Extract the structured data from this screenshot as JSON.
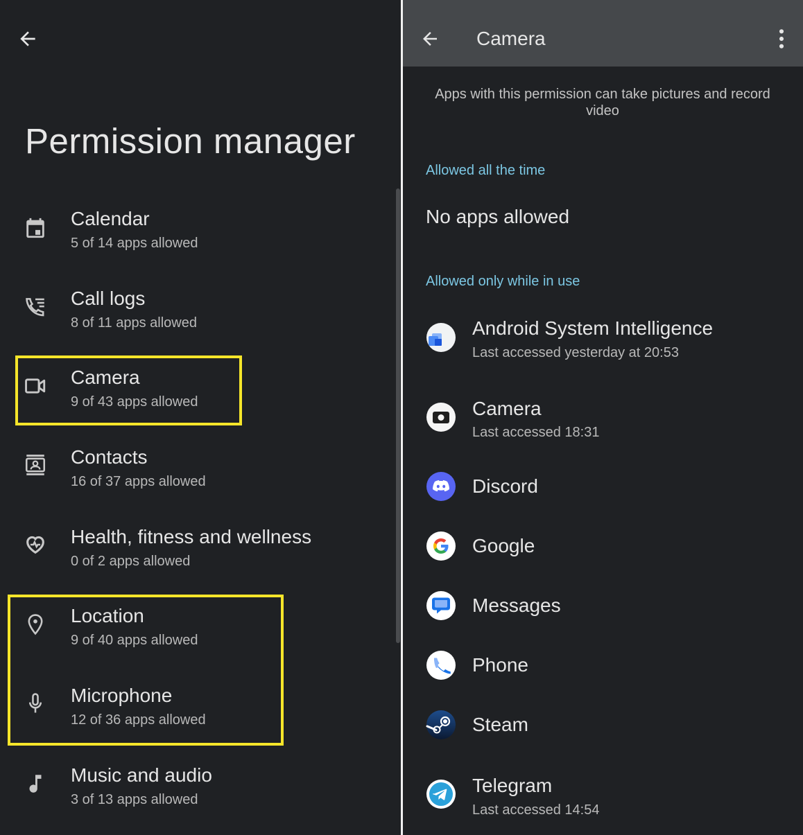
{
  "left": {
    "title": "Permission manager",
    "permissions": [
      {
        "label": "Calendar",
        "summary": "5 of 14 apps allowed",
        "icon": "calendar-icon"
      },
      {
        "label": "Call logs",
        "summary": "8 of 11 apps allowed",
        "icon": "call-log-icon"
      },
      {
        "label": "Camera",
        "summary": "9 of 43 apps allowed",
        "icon": "camera-icon"
      },
      {
        "label": "Contacts",
        "summary": "16 of 37 apps allowed",
        "icon": "contacts-icon"
      },
      {
        "label": "Health, fitness and wellness",
        "summary": "0 of 2 apps allowed",
        "icon": "health-icon"
      },
      {
        "label": "Location",
        "summary": "9 of 40 apps allowed",
        "icon": "location-icon"
      },
      {
        "label": "Microphone",
        "summary": "12 of 36 apps allowed",
        "icon": "microphone-icon"
      },
      {
        "label": "Music and audio",
        "summary": "3 of 13 apps allowed",
        "icon": "music-icon"
      }
    ]
  },
  "right": {
    "title": "Camera",
    "description": "Apps with this permission can take pictures and record video",
    "allowed_all_time_header": "Allowed all the time",
    "allowed_all_time_empty": "No apps allowed",
    "allowed_in_use_header": "Allowed only while in use",
    "apps": [
      {
        "name": "Android System Intelligence",
        "detail": "Last accessed yesterday at 20:53",
        "icon": "android-system-intelligence-icon"
      },
      {
        "name": "Camera",
        "detail": "Last accessed 18:31",
        "icon": "camera-app-icon"
      },
      {
        "name": "Discord",
        "detail": "",
        "icon": "discord-icon"
      },
      {
        "name": "Google",
        "detail": "",
        "icon": "google-icon"
      },
      {
        "name": "Messages",
        "detail": "",
        "icon": "messages-icon"
      },
      {
        "name": "Phone",
        "detail": "",
        "icon": "phone-icon"
      },
      {
        "name": "Steam",
        "detail": "",
        "icon": "steam-icon"
      },
      {
        "name": "Telegram",
        "detail": "Last accessed 14:54",
        "icon": "telegram-icon"
      }
    ]
  },
  "colors": {
    "background": "#1f2124",
    "app_bar": "#45484b",
    "section_header": "#7cc7e3",
    "highlight_box": "#f5e52a"
  }
}
